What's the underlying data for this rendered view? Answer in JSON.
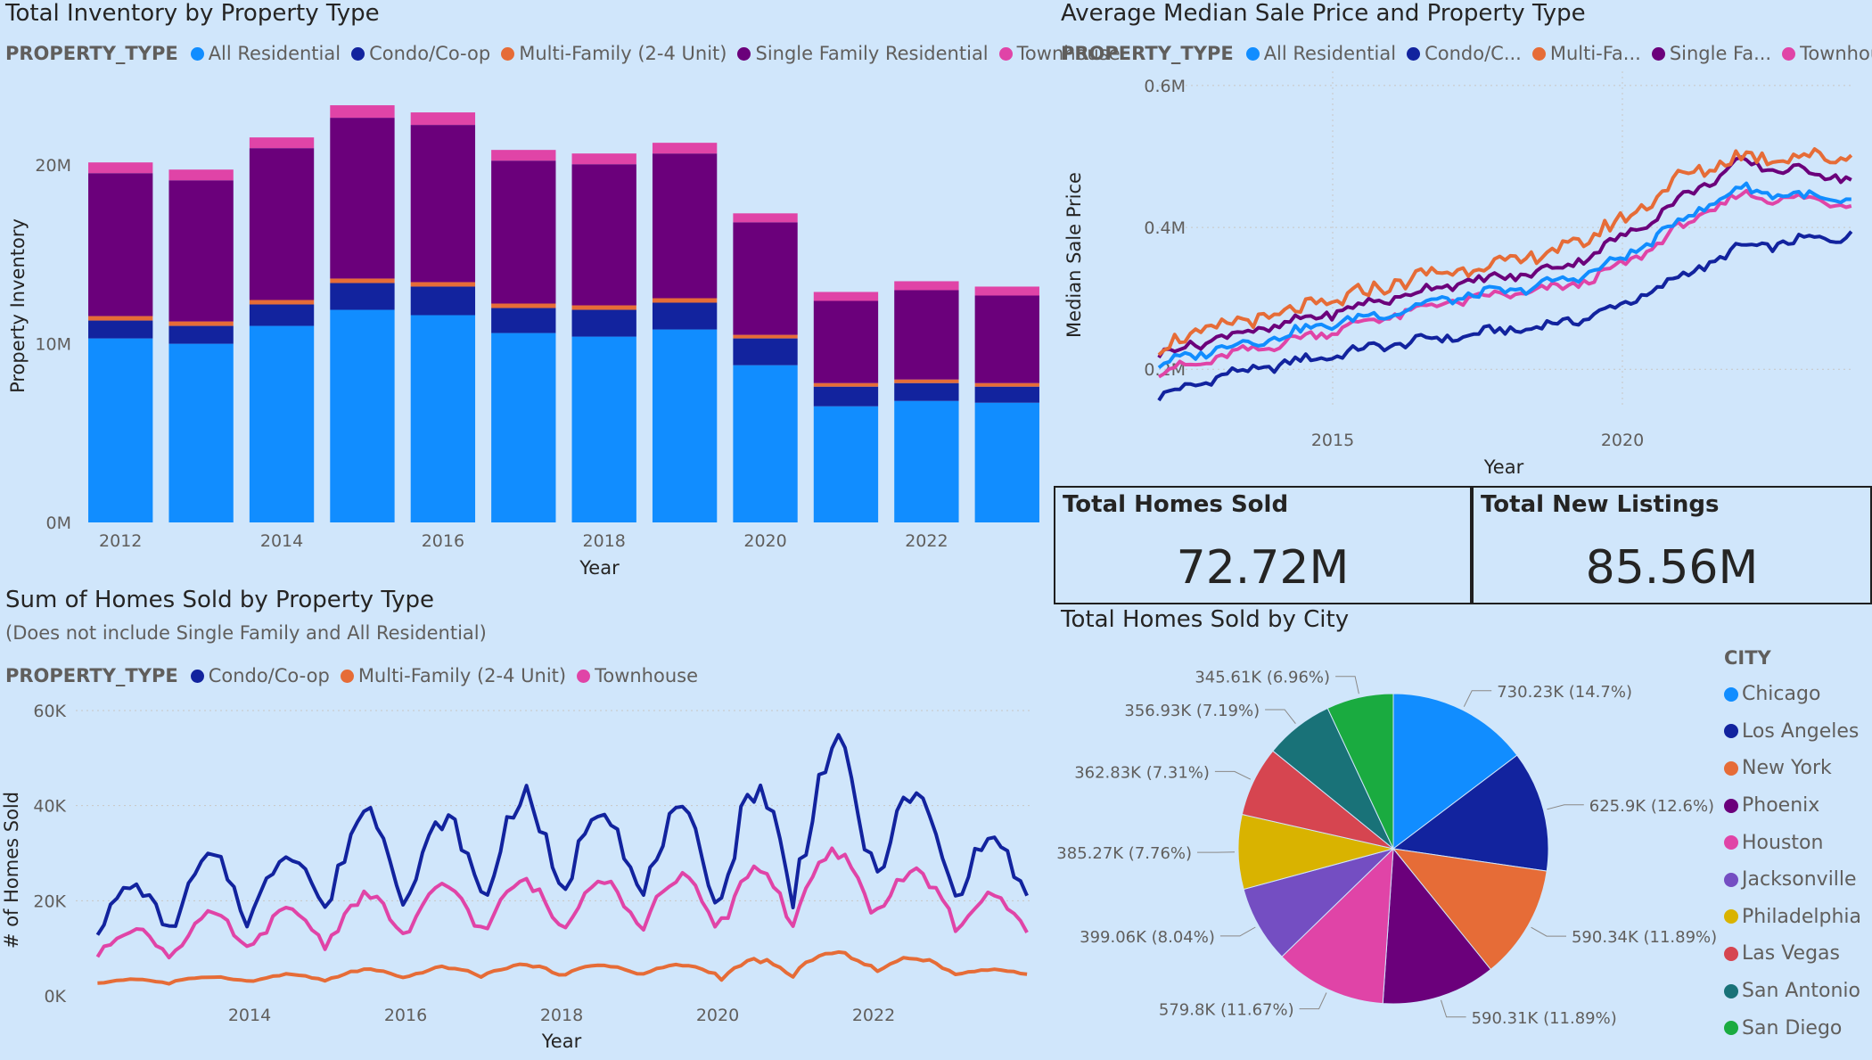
{
  "inventory": {
    "title": "Total Inventory by Property Type",
    "legend_title": "PROPERTY_TYPE",
    "legend": [
      {
        "name": "All Residential",
        "color": "#118dff"
      },
      {
        "name": "Condo/Co-op",
        "color": "#12239e"
      },
      {
        "name": "Multi-Family (2-4 Unit)",
        "color": "#e66c37"
      },
      {
        "name": "Single Family Residential",
        "color": "#6b007b"
      },
      {
        "name": "Townhouse",
        "color": "#e044a7"
      }
    ]
  },
  "price": {
    "title": "Average Median Sale Price and Property Type",
    "legend_title": "PROPERTY_TYPE",
    "legend": [
      {
        "name": "All Residential",
        "color": "#118dff"
      },
      {
        "name": "Condo/C...",
        "color": "#12239e"
      },
      {
        "name": "Multi-Fa...",
        "color": "#e66c37"
      },
      {
        "name": "Single Fa...",
        "color": "#6b007b"
      },
      {
        "name": "Townhouse",
        "color": "#e044a7"
      }
    ]
  },
  "sold": {
    "title": "Sum of Homes Sold by Property Type",
    "subtitle": "(Does not include Single Family and All Residential)",
    "legend_title": "PROPERTY_TYPE",
    "legend": [
      {
        "name": "Condo/Co-op",
        "color": "#12239e"
      },
      {
        "name": "Multi-Family (2-4 Unit)",
        "color": "#e66c37"
      },
      {
        "name": "Townhouse",
        "color": "#e044a7"
      }
    ]
  },
  "cards": [
    {
      "title": "Total Homes Sold",
      "value": "72.72M"
    },
    {
      "title": "Total New Listings",
      "value": "85.56M"
    }
  ],
  "city": {
    "title": "Total Homes Sold by City",
    "legend_title": "CITY"
  },
  "chart_data": [
    {
      "type": "bar",
      "stacked": true,
      "title": "Total Inventory by Property Type",
      "xlabel": "Year",
      "ylabel": "Property Inventory",
      "ylim": [
        0,
        25000000
      ],
      "yticks": [
        {
          "v": 0,
          "label": "0M"
        },
        {
          "v": 10000000,
          "label": "10M"
        },
        {
          "v": 20000000,
          "label": "20M"
        }
      ],
      "xtick_labels": [
        "2012",
        "2014",
        "2016",
        "2018",
        "2020",
        "2022"
      ],
      "categories": [
        "2012",
        "2013",
        "2014",
        "2015",
        "2016",
        "2017",
        "2018",
        "2019",
        "2020",
        "2021",
        "2022",
        "2023"
      ],
      "series": [
        {
          "name": "All Residential",
          "color": "#118dff",
          "values": [
            10300000,
            10000000,
            11000000,
            11900000,
            11600000,
            10600000,
            10400000,
            10800000,
            8800000,
            6500000,
            6800000,
            6700000
          ]
        },
        {
          "name": "Condo/Co-op",
          "color": "#12239e",
          "values": [
            1000000,
            1000000,
            1200000,
            1500000,
            1600000,
            1400000,
            1500000,
            1500000,
            1500000,
            1100000,
            1000000,
            900000
          ]
        },
        {
          "name": "Multi-Family (2-4 Unit)",
          "color": "#e66c37",
          "values": [
            250000,
            250000,
            250000,
            250000,
            250000,
            250000,
            250000,
            250000,
            200000,
            200000,
            200000,
            200000
          ]
        },
        {
          "name": "Single Family Residential",
          "color": "#6b007b",
          "values": [
            8000000,
            7900000,
            8500000,
            9000000,
            8800000,
            8000000,
            7900000,
            8100000,
            6300000,
            4600000,
            5000000,
            4900000
          ]
        },
        {
          "name": "Townhouse",
          "color": "#e044a7",
          "values": [
            600000,
            600000,
            600000,
            700000,
            700000,
            600000,
            600000,
            600000,
            500000,
            500000,
            500000,
            500000
          ]
        }
      ]
    },
    {
      "type": "line",
      "title": "Average Median Sale Price and Property Type",
      "xlabel": "Year",
      "ylabel": "Median Sale Price",
      "xlim": [
        2012,
        2024
      ],
      "ylim": [
        0.15,
        0.62
      ],
      "yticks": [
        {
          "v": 0.2,
          "label": "0.2M"
        },
        {
          "v": 0.4,
          "label": "0.4M"
        },
        {
          "v": 0.6,
          "label": "0.6M"
        }
      ],
      "xticks": [
        2015,
        2020
      ],
      "y_unit": "M",
      "x": [
        2012,
        2013,
        2014,
        2015,
        2016,
        2017,
        2018,
        2019,
        2020,
        2021,
        2022,
        2023
      ],
      "series": [
        {
          "name": "Condo/C...",
          "color": "#12239e",
          "values": [
            0.16,
            0.19,
            0.205,
            0.22,
            0.235,
            0.245,
            0.255,
            0.265,
            0.29,
            0.33,
            0.37,
            0.38
          ]
        },
        {
          "name": "Townhouse",
          "color": "#e044a7",
          "values": [
            0.195,
            0.215,
            0.235,
            0.255,
            0.275,
            0.295,
            0.305,
            0.315,
            0.345,
            0.4,
            0.445,
            0.44
          ]
        },
        {
          "name": "All Residential",
          "color": "#118dff",
          "values": [
            0.205,
            0.23,
            0.245,
            0.265,
            0.28,
            0.3,
            0.31,
            0.325,
            0.355,
            0.41,
            0.455,
            0.445
          ]
        },
        {
          "name": "Single Fa...",
          "color": "#6b007b",
          "values": [
            0.22,
            0.245,
            0.26,
            0.28,
            0.3,
            0.32,
            0.33,
            0.345,
            0.385,
            0.44,
            0.49,
            0.48
          ]
        },
        {
          "name": "Multi-Fa...",
          "color": "#e66c37",
          "values": [
            0.23,
            0.26,
            0.275,
            0.295,
            0.32,
            0.34,
            0.35,
            0.37,
            0.41,
            0.47,
            0.5,
            0.5
          ]
        }
      ]
    },
    {
      "type": "line",
      "title": "Sum of Homes Sold by Property Type",
      "xlabel": "Year",
      "ylabel": "# of Homes Sold",
      "xlim": [
        2012,
        2024
      ],
      "ylim": [
        0,
        60000
      ],
      "yticks": [
        {
          "v": 0,
          "label": "0K"
        },
        {
          "v": 20000,
          "label": "20K"
        },
        {
          "v": 40000,
          "label": "40K"
        },
        {
          "v": 60000,
          "label": "60K"
        }
      ],
      "xticks": [
        2014,
        2016,
        2018,
        2020,
        2022
      ],
      "x": [
        2012,
        2013,
        2014,
        2015,
        2016,
        2017,
        2018,
        2019,
        2020,
        2021,
        2022,
        2023
      ],
      "series": [
        {
          "name": "Condo/Co-op",
          "color": "#12239e",
          "peaks": [
            23000,
            29000,
            30000,
            39000,
            37000,
            42000,
            40000,
            38000,
            44000,
            52000,
            42000,
            33000
          ],
          "troughs": [
            13000,
            15000,
            17000,
            20000,
            20000,
            20000,
            21000,
            20000,
            18000,
            25000,
            24000,
            19000
          ]
        },
        {
          "name": "Townhouse",
          "color": "#e044a7",
          "peaks": [
            14000,
            17000,
            18000,
            21000,
            23000,
            24000,
            25000,
            25000,
            27000,
            30000,
            26000,
            21000
          ],
          "troughs": [
            8000,
            9000,
            10000,
            12000,
            13000,
            14000,
            14000,
            14000,
            14000,
            18000,
            17000,
            13000
          ]
        },
        {
          "name": "Multi-Family (2-4 Unit)",
          "color": "#e66c37",
          "peaks": [
            3500,
            4000,
            4500,
            5500,
            6000,
            6500,
            6500,
            6500,
            7500,
            9000,
            8000,
            5500
          ],
          "troughs": [
            2500,
            3000,
            3000,
            3500,
            4000,
            4500,
            4500,
            4500,
            3500,
            6000,
            5000,
            4500
          ]
        }
      ]
    },
    {
      "type": "pie",
      "title": "Total Homes Sold by City",
      "slices": [
        {
          "name": "Chicago",
          "value": 730.23,
          "label": "730.23K (14.7%)",
          "color": "#118dff"
        },
        {
          "name": "Los Angeles",
          "value": 625.9,
          "label": "625.9K (12.6%)",
          "color": "#12239e"
        },
        {
          "name": "New York",
          "value": 590.34,
          "label": "590.34K (11.89%)",
          "color": "#e66c37"
        },
        {
          "name": "Phoenix",
          "value": 590.31,
          "label": "590.31K (11.89%)",
          "color": "#6b007b"
        },
        {
          "name": "Houston",
          "value": 579.8,
          "label": "579.8K (11.67%)",
          "color": "#e044a7"
        },
        {
          "name": "Jacksonville",
          "value": 399.06,
          "label": "399.06K (8.04%)",
          "color": "#744ec2"
        },
        {
          "name": "Philadelphia",
          "value": 385.27,
          "label": "385.27K (7.76%)",
          "color": "#d9b300"
        },
        {
          "name": "Las Vegas",
          "value": 362.83,
          "label": "362.83K (7.31%)",
          "color": "#d64550"
        },
        {
          "name": "San Antonio",
          "value": 356.93,
          "label": "356.93K (7.19%)",
          "color": "#197278"
        },
        {
          "name": "San Diego",
          "value": 345.61,
          "label": "345.61K (6.96%)",
          "color": "#1aab40"
        }
      ]
    }
  ]
}
